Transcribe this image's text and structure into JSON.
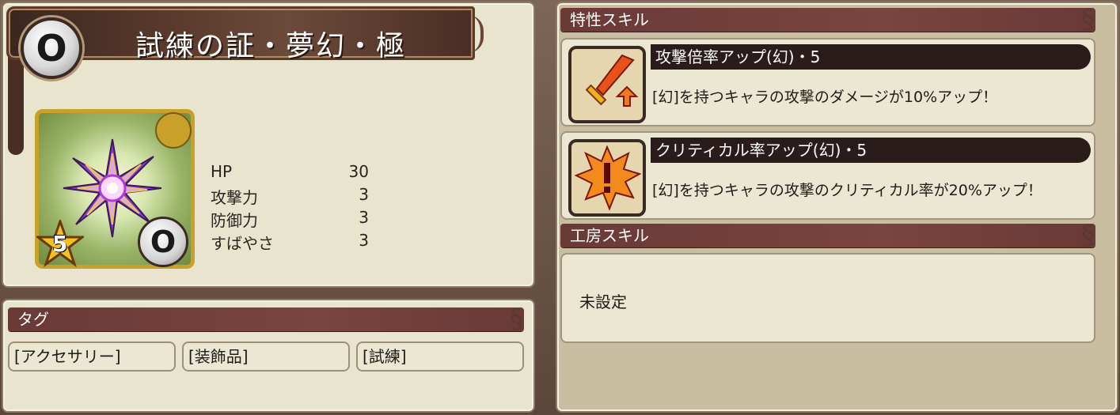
{
  "item": {
    "name": "試練の証・夢幻・極",
    "rarity": "5",
    "ring_glyph": "O",
    "stats": [
      {
        "label": "HP",
        "value": "30"
      },
      {
        "label": "攻撃力",
        "value": "3"
      },
      {
        "label": "防御力",
        "value": "3"
      },
      {
        "label": "すばやさ",
        "value": "3"
      }
    ]
  },
  "tags": {
    "header": "タグ",
    "items": [
      "[アクセサリー]",
      "[装飾品]",
      "[試練]"
    ]
  },
  "traits": {
    "header": "特性スキル",
    "skills": [
      {
        "title": "攻撃倍率アップ(幻)・5",
        "desc": "[幻]を持つキャラの攻撃のダメージが10%アップ！",
        "icon": "sword-up-icon"
      },
      {
        "title": "クリティカル率アップ(幻)・5",
        "desc": "[幻]を持つキャラの攻撃のクリティカル率が20%アップ！",
        "icon": "critical-up-icon"
      }
    ]
  },
  "workshop": {
    "header": "工房スキル",
    "value": "未設定"
  },
  "colors": {
    "header_bg": "#6a3a36",
    "panel_bg": "#e9e4ce",
    "card_border": "#c9a02a"
  }
}
